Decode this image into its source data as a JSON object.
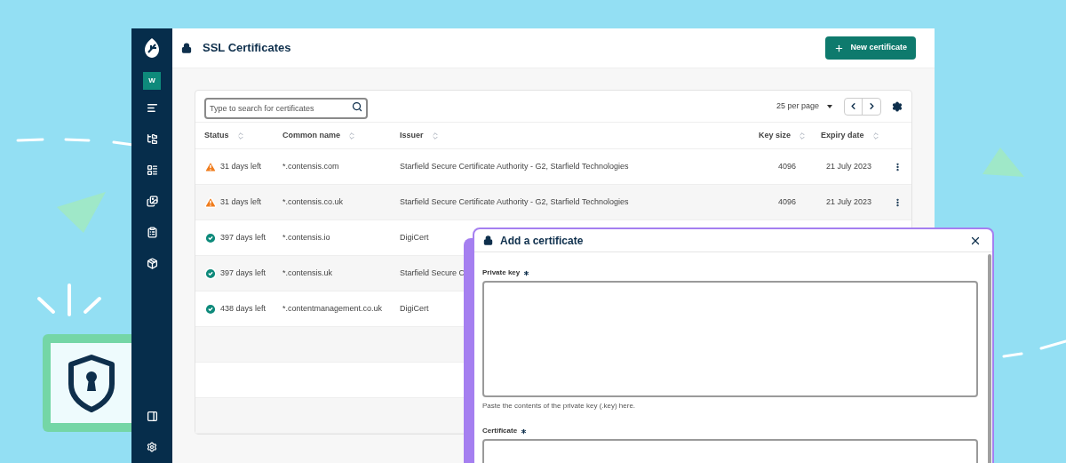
{
  "sidebar": {
    "workspace_badge": "W"
  },
  "header": {
    "title": "SSL Certificates",
    "new_button": "New certificate"
  },
  "table": {
    "search": {
      "placeholder": "Type to search for certificates"
    },
    "per_page": "25 per page",
    "columns": [
      "Status",
      "Common name",
      "Issuer",
      "Key size",
      "Expiry date"
    ],
    "rows": [
      {
        "kind": "warning",
        "status": "31 days left",
        "common_name": "*.contensis.com",
        "issuer": "Starfield Secure Certificate Authority - G2, Starfield Technologies",
        "key_size": "4096",
        "expiry": "21 July 2023"
      },
      {
        "kind": "warning",
        "status": "31 days left",
        "common_name": "*.contensis.co.uk",
        "issuer": "Starfield Secure Certificate Authority - G2, Starfield Technologies",
        "key_size": "4096",
        "expiry": "21 July 2023"
      },
      {
        "kind": "ok",
        "status": "397 days left",
        "common_name": "*.contensis.io",
        "issuer": "DigiCert"
      },
      {
        "kind": "ok",
        "status": "397 days left",
        "common_name": "*.contensis.uk",
        "issuer": "Starfield Secure C"
      },
      {
        "kind": "ok",
        "status": "438 days left",
        "common_name": "*.contentmanagement.co.uk",
        "issuer": "DigiCert"
      }
    ]
  },
  "dialog": {
    "title": "Add a certificate",
    "fields": [
      {
        "label": "Private key",
        "required": true,
        "hint": "Paste the contents of the private key (.key) here."
      },
      {
        "label": "Certificate",
        "required": true
      }
    ]
  }
}
